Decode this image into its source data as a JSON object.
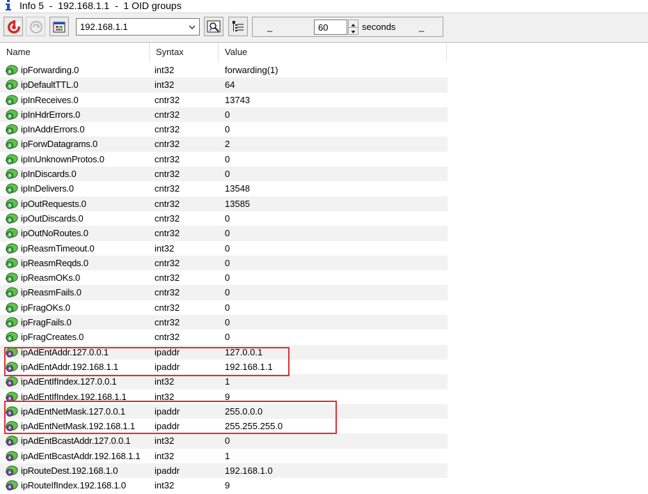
{
  "window": {
    "title": "Info 5  -  192.168.1.1  -  1 OID groups"
  },
  "toolbar": {
    "host_value": "192.168.1.1",
    "interval_value": "60",
    "interval_unit": "seconds",
    "dash_left": "_",
    "dash_right": "_"
  },
  "table": {
    "columns": [
      "Name",
      "Syntax",
      "Value"
    ],
    "rows": [
      {
        "name": "ipForwarding.0",
        "syntax": "int32",
        "value": "forwarding(1)",
        "icon": "leaf-green-icon"
      },
      {
        "name": "ipDefaultTTL.0",
        "syntax": "int32",
        "value": "64",
        "icon": "leaf-green-icon"
      },
      {
        "name": "ipInReceives.0",
        "syntax": "cntr32",
        "value": "13743",
        "icon": "leaf-green-icon"
      },
      {
        "name": "ipInHdrErrors.0",
        "syntax": "cntr32",
        "value": "0",
        "icon": "leaf-green-icon"
      },
      {
        "name": "ipInAddrErrors.0",
        "syntax": "cntr32",
        "value": "0",
        "icon": "leaf-green-icon"
      },
      {
        "name": "ipForwDatagrams.0",
        "syntax": "cntr32",
        "value": "2",
        "icon": "leaf-green-icon"
      },
      {
        "name": "ipInUnknownProtos.0",
        "syntax": "cntr32",
        "value": "0",
        "icon": "leaf-green-icon"
      },
      {
        "name": "ipInDiscards.0",
        "syntax": "cntr32",
        "value": "0",
        "icon": "leaf-green-icon"
      },
      {
        "name": "ipInDelivers.0",
        "syntax": "cntr32",
        "value": "13548",
        "icon": "leaf-green-icon"
      },
      {
        "name": "ipOutRequests.0",
        "syntax": "cntr32",
        "value": "13585",
        "icon": "leaf-green-icon"
      },
      {
        "name": "ipOutDiscards.0",
        "syntax": "cntr32",
        "value": "0",
        "icon": "leaf-green-icon"
      },
      {
        "name": "ipOutNoRoutes.0",
        "syntax": "cntr32",
        "value": "0",
        "icon": "leaf-green-icon"
      },
      {
        "name": "ipReasmTimeout.0",
        "syntax": "int32",
        "value": "0",
        "icon": "leaf-green-icon"
      },
      {
        "name": "ipReasmReqds.0",
        "syntax": "cntr32",
        "value": "0",
        "icon": "leaf-green-icon"
      },
      {
        "name": "ipReasmOKs.0",
        "syntax": "cntr32",
        "value": "0",
        "icon": "leaf-green-icon"
      },
      {
        "name": "ipReasmFails.0",
        "syntax": "cntr32",
        "value": "0",
        "icon": "leaf-green-icon"
      },
      {
        "name": "ipFragOKs.0",
        "syntax": "cntr32",
        "value": "0",
        "icon": "leaf-green-icon"
      },
      {
        "name": "ipFragFails.0",
        "syntax": "cntr32",
        "value": "0",
        "icon": "leaf-green-icon"
      },
      {
        "name": "ipFragCreates.0",
        "syntax": "cntr32",
        "value": "0",
        "icon": "leaf-green-icon"
      },
      {
        "name": "ipAdEntAddr.127.0.0.1",
        "syntax": "ipaddr",
        "value": "127.0.0.1",
        "icon": "leaf-purple-icon"
      },
      {
        "name": "ipAdEntAddr.192.168.1.1",
        "syntax": "ipaddr",
        "value": "192.168.1.1",
        "icon": "leaf-purple-icon"
      },
      {
        "name": "ipAdEntIfIndex.127.0.0.1",
        "syntax": "int32",
        "value": "1",
        "icon": "leaf-purple-icon"
      },
      {
        "name": "ipAdEntIfIndex.192.168.1.1",
        "syntax": "int32",
        "value": "9",
        "icon": "leaf-purple-icon"
      },
      {
        "name": "ipAdEntNetMask.127.0.0.1",
        "syntax": "ipaddr",
        "value": "255.0.0.0",
        "icon": "leaf-purple-icon"
      },
      {
        "name": "ipAdEntNetMask.192.168.1.1",
        "syntax": "ipaddr",
        "value": "255.255.255.0",
        "icon": "leaf-purple-icon"
      },
      {
        "name": "ipAdEntBcastAddr.127.0.0.1",
        "syntax": "int32",
        "value": "0",
        "icon": "leaf-purple-icon"
      },
      {
        "name": "ipAdEntBcastAddr.192.168.1.1",
        "syntax": "int32",
        "value": "1",
        "icon": "leaf-purple-icon"
      },
      {
        "name": "ipRouteDest.192.168.1.0",
        "syntax": "ipaddr",
        "value": "192.168.1.0",
        "icon": "leaf-purple-icon"
      },
      {
        "name": "ipRouteIfIndex.192.168.1.0",
        "syntax": "int32",
        "value": "9",
        "icon": "leaf-purple-icon"
      }
    ]
  },
  "colors": {
    "highlight_box": "#d9343a",
    "leaf_green": "#3cb44a",
    "leaf_purple": "#7b3fa0",
    "stripe": "#f2f2f2"
  }
}
